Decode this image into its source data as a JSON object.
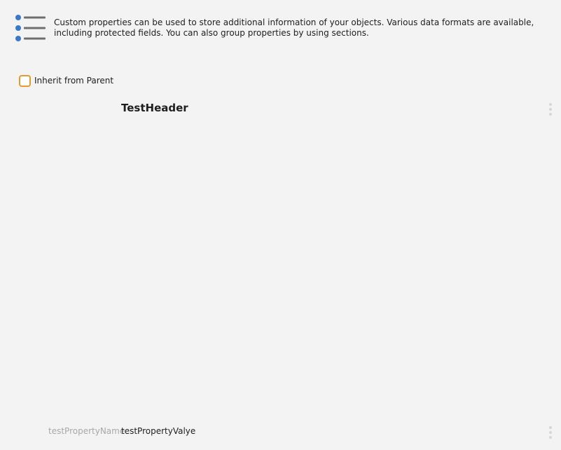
{
  "header": {
    "icon": "list-icon",
    "description": "Custom properties can be used to store additional information of your objects. Various data formats are available, including protected fields. You can also group properties by using sections."
  },
  "inherit": {
    "label": "Inherit from Parent",
    "checked": false
  },
  "section": {
    "title": "TestHeader",
    "menu_icon": "kebab-menu-icon"
  },
  "properties": [
    {
      "name": "testPropertyName",
      "value": "testPropertyValye",
      "menu_icon": "kebab-menu-icon"
    }
  ],
  "colors": {
    "background": "#f3f3f3",
    "accent_icon": "#3a78c9",
    "checkbox_border": "#e49b2b",
    "muted_text": "#a8a8a8"
  }
}
